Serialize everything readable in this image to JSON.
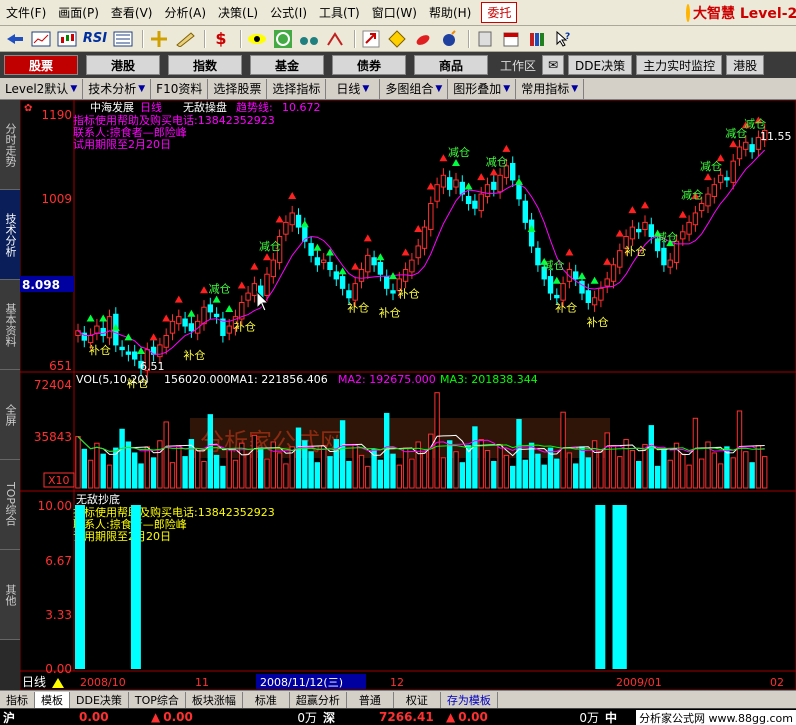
{
  "menu": {
    "items": [
      "文件(F)",
      "画面(P)",
      "查看(V)",
      "分析(A)",
      "决策(L)",
      "公式(I)",
      "工具(T)",
      "窗口(W)",
      "帮助(H)"
    ],
    "entrust_label": "委托",
    "brand": "大智慧 Level-2"
  },
  "toolbar": {
    "icons": [
      "back-icon",
      "minute-chart-icon",
      "kline-chart-icon",
      "rsi-icon",
      "indicator-icon",
      "crosshair-icon",
      "ruler-icon",
      "dollar-icon",
      "eye-icon",
      "refresh-icon",
      "binoculars-icon",
      "bull-icon",
      "arrow-up-icon",
      "diamond-icon",
      "chili-icon",
      "bomb-icon",
      "notebook-icon",
      "calendar-icon",
      "books-icon",
      "help-pointer-icon"
    ],
    "rsi_label": "RSI",
    "dollar_label": "$"
  },
  "market_tabs": {
    "tabs": [
      "股票",
      "港股",
      "指数",
      "基金",
      "债券",
      "商品"
    ],
    "active": "股票",
    "workspace_label": "工作区",
    "buttons": [
      "DDE决策",
      "主力实时监控",
      "港股"
    ]
  },
  "subbar": {
    "items": [
      "Level2默认",
      "技术分析",
      "F10资料",
      "选择股票",
      "选择指标",
      "日线",
      "多图组合",
      "图形叠加",
      "常用指标"
    ]
  },
  "left_tabs": [
    "分时走势",
    "技术分析",
    "基本资料",
    "全屏",
    "TOP综合",
    "其他"
  ],
  "left_tabs_active": "技术分析",
  "chart": {
    "stock_name": "中海发展",
    "period": "日线",
    "indicator_name": "无敌操盘",
    "trend_label": "趋势线:",
    "trend_value": "10.672",
    "contact_phone": "指标使用帮助及购买电话:13842352923",
    "contact_person": "联系人:掠食者—郎险峰",
    "trial": "试用期限至2月20日",
    "price_axis": [
      "1190",
      "1009",
      "8.098",
      "651"
    ],
    "current_price": "8.098",
    "high_label": "11.55",
    "low_label": "6.51",
    "buy_label": "补仓",
    "sell_label": "减仓",
    "volume_header": {
      "title": "VOL(5,10,20)",
      "vol": "156020.000",
      "ma1": "MA1: 221856.406",
      "ma2": "MA2: 192675.000",
      "ma3": "MA3: 201838.344"
    },
    "volume_axis": [
      "72404",
      "35843",
      "X10"
    ],
    "indicator2_name": "无敌抄底",
    "indicator2_axis": [
      "10.00",
      "6.67",
      "3.33",
      "0.00"
    ],
    "watermark": "分析家公式网"
  },
  "chart_data": {
    "type": "candlestick",
    "xlabels": [
      "2008/10",
      "11",
      "2008/11/12(三)",
      "12",
      "2009/01",
      "02"
    ],
    "price_range": [
      6.51,
      11.9
    ],
    "close": [
      7.3,
      7.1,
      7.2,
      7.4,
      7.2,
      7.6,
      7.0,
      6.9,
      6.8,
      6.7,
      6.51,
      6.9,
      6.8,
      7.0,
      7.2,
      7.5,
      7.6,
      7.4,
      7.3,
      7.5,
      7.8,
      7.7,
      7.6,
      7.2,
      7.4,
      7.6,
      7.9,
      8.1,
      8.3,
      8.0,
      8.5,
      8.8,
      9.3,
      9.6,
      9.8,
      9.5,
      9.2,
      8.9,
      8.7,
      8.8,
      8.6,
      8.4,
      8.2,
      8.0,
      8.3,
      8.6,
      8.9,
      8.7,
      8.5,
      8.2,
      8.1,
      8.4,
      8.6,
      8.8,
      9.1,
      9.5,
      10.0,
      10.4,
      10.6,
      10.3,
      10.5,
      10.2,
      10.0,
      9.9,
      10.2,
      10.4,
      10.3,
      10.6,
      10.8,
      10.5,
      10.1,
      9.6,
      9.1,
      8.7,
      8.4,
      8.1,
      8.0,
      8.3,
      8.6,
      8.4,
      8.1,
      7.9,
      8.0,
      8.2,
      8.4,
      8.7,
      9.0,
      9.3,
      9.5,
      9.4,
      9.6,
      9.3,
      9.0,
      8.7,
      8.8,
      9.2,
      9.4,
      9.6,
      9.8,
      10.0,
      10.2,
      10.4,
      10.6,
      10.5,
      10.9,
      11.2,
      11.3,
      11.1,
      11.4,
      11.55
    ],
    "volume_range": [
      0,
      72404
    ],
    "indicator2_range": [
      0,
      10
    ],
    "indicator2_bars": [
      [
        0,
        10
      ],
      [
        13,
        10
      ],
      [
        121,
        10
      ],
      [
        125,
        10
      ],
      [
        126,
        10
      ]
    ]
  },
  "bottom_tabs": {
    "items": [
      "指标",
      "模板",
      "DDE决策",
      "TOP综合",
      "板块涨幅",
      "标准",
      "超赢分析",
      "普通",
      "权证",
      "存为模板"
    ],
    "active": "模板",
    "highlight": "存为模板",
    "period": "日线"
  },
  "status": {
    "sh_name": "沪",
    "sh_value": "0.00",
    "sh_change": "0.00",
    "sh_volume": "0万",
    "sz_name": "深",
    "sz_value": "7266.41",
    "sz_change": "0.00",
    "sz_volume": "0万",
    "zh_name": "中",
    "footer": "分析家公式网 www.88gg.com"
  }
}
